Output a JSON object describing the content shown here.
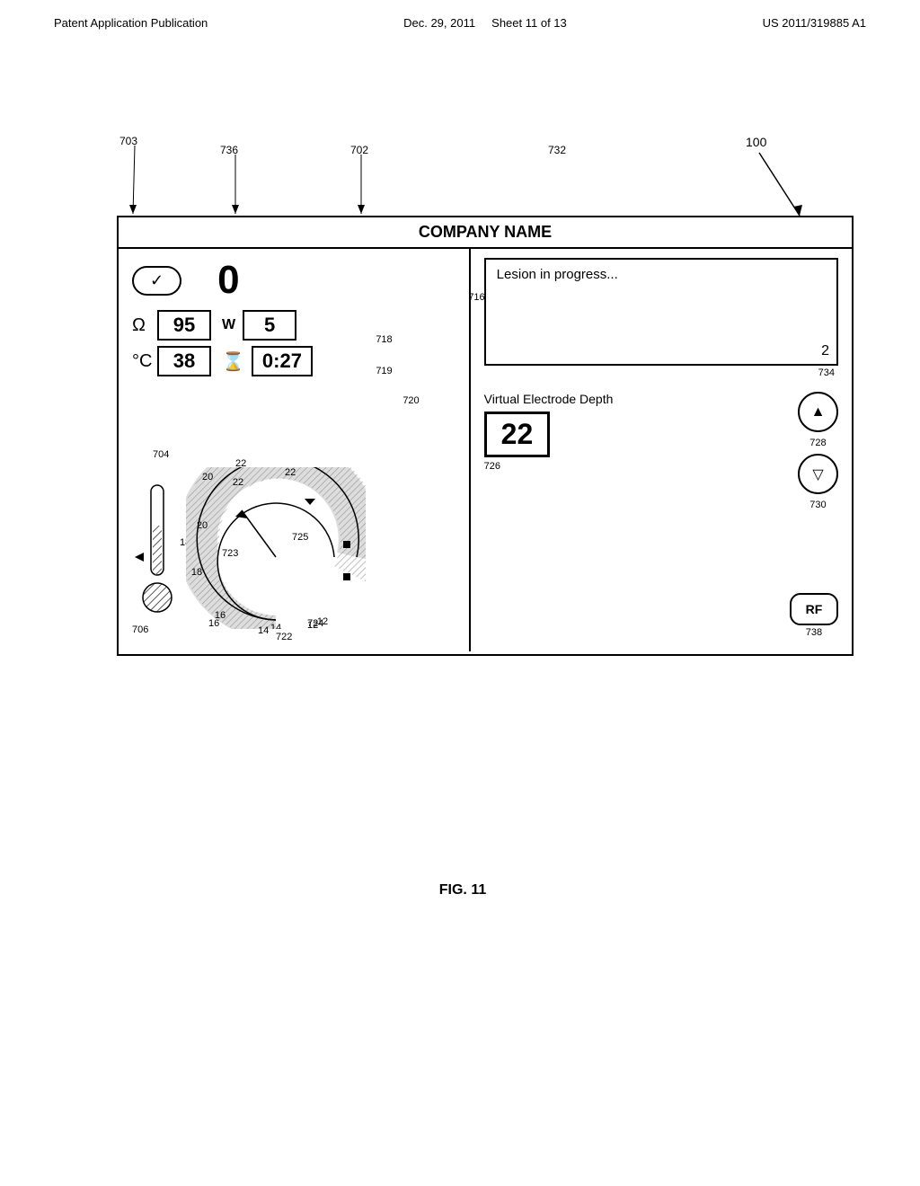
{
  "header": {
    "left": "Patent Application Publication",
    "date": "Dec. 29, 2011",
    "sheet": "Sheet 11 of 13",
    "patent": "US 2011/319885 A1"
  },
  "figure": {
    "caption": "FIG. 11",
    "device_number": "100",
    "company_name": "COMPANY NAME",
    "status_text": "Lesion in progress...",
    "checkbox_symbol": "✓",
    "main_value": "0",
    "impedance_symbol": "Ω",
    "impedance_value": "95",
    "power_symbol": "W",
    "power_value": "5",
    "temp_symbol": "°C",
    "temp_value": "38",
    "timer_symbol": "⏳",
    "timer_value": "0:27",
    "virtual_electrode_label": "Virtual Electrode Depth",
    "virtual_electrode_value": "22",
    "corner_value": "2",
    "rf_label": "RF",
    "gauge_labels": [
      "12",
      "14",
      "16",
      "18",
      "20",
      "22"
    ],
    "gauge_center_label": "22",
    "ref_numbers": {
      "device": "100",
      "r703": "703",
      "r736": "736",
      "r702": "702",
      "r732": "732",
      "r716": "716",
      "r718": "718",
      "r719": "719",
      "r720": "720",
      "r704": "704",
      "r22": "22",
      "r20": "20",
      "r18": "18",
      "r706": "706",
      "r16": "16",
      "r14": "14",
      "r12": "12",
      "r723": "723",
      "r725": "725",
      "r722": "722",
      "r724": "724",
      "r726": "726",
      "r728": "728",
      "r730": "730",
      "r734": "734",
      "r738": "738"
    }
  }
}
